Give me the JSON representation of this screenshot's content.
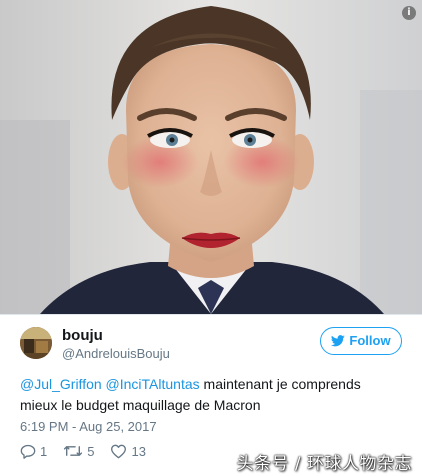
{
  "tweet": {
    "author": {
      "name": "bouju",
      "handle": "@AndrelouisBouju"
    },
    "follow_label": "Follow",
    "text": {
      "mention_1": "@Jul_Griffon",
      "mention_2": "@InciTAltuntas",
      "line_1_rest": " maintenant je comprends",
      "line_2": "mieux le budget maquillage de Macron"
    },
    "timestamp": "6:19 PM - Aug 25, 2017",
    "actions": {
      "replies": "1",
      "retweets": "5",
      "likes": "13"
    }
  },
  "watermark": "头条号 / 环球人物杂志",
  "icons": {
    "info": "info-icon",
    "follow": "twitter-bird-icon",
    "reply": "reply-icon",
    "retweet": "retweet-icon",
    "like": "heart-icon"
  },
  "colors": {
    "accent": "#1da1f2",
    "mention": "#1b95e0",
    "secondary_text": "#657786",
    "primary_text": "#14171a"
  }
}
